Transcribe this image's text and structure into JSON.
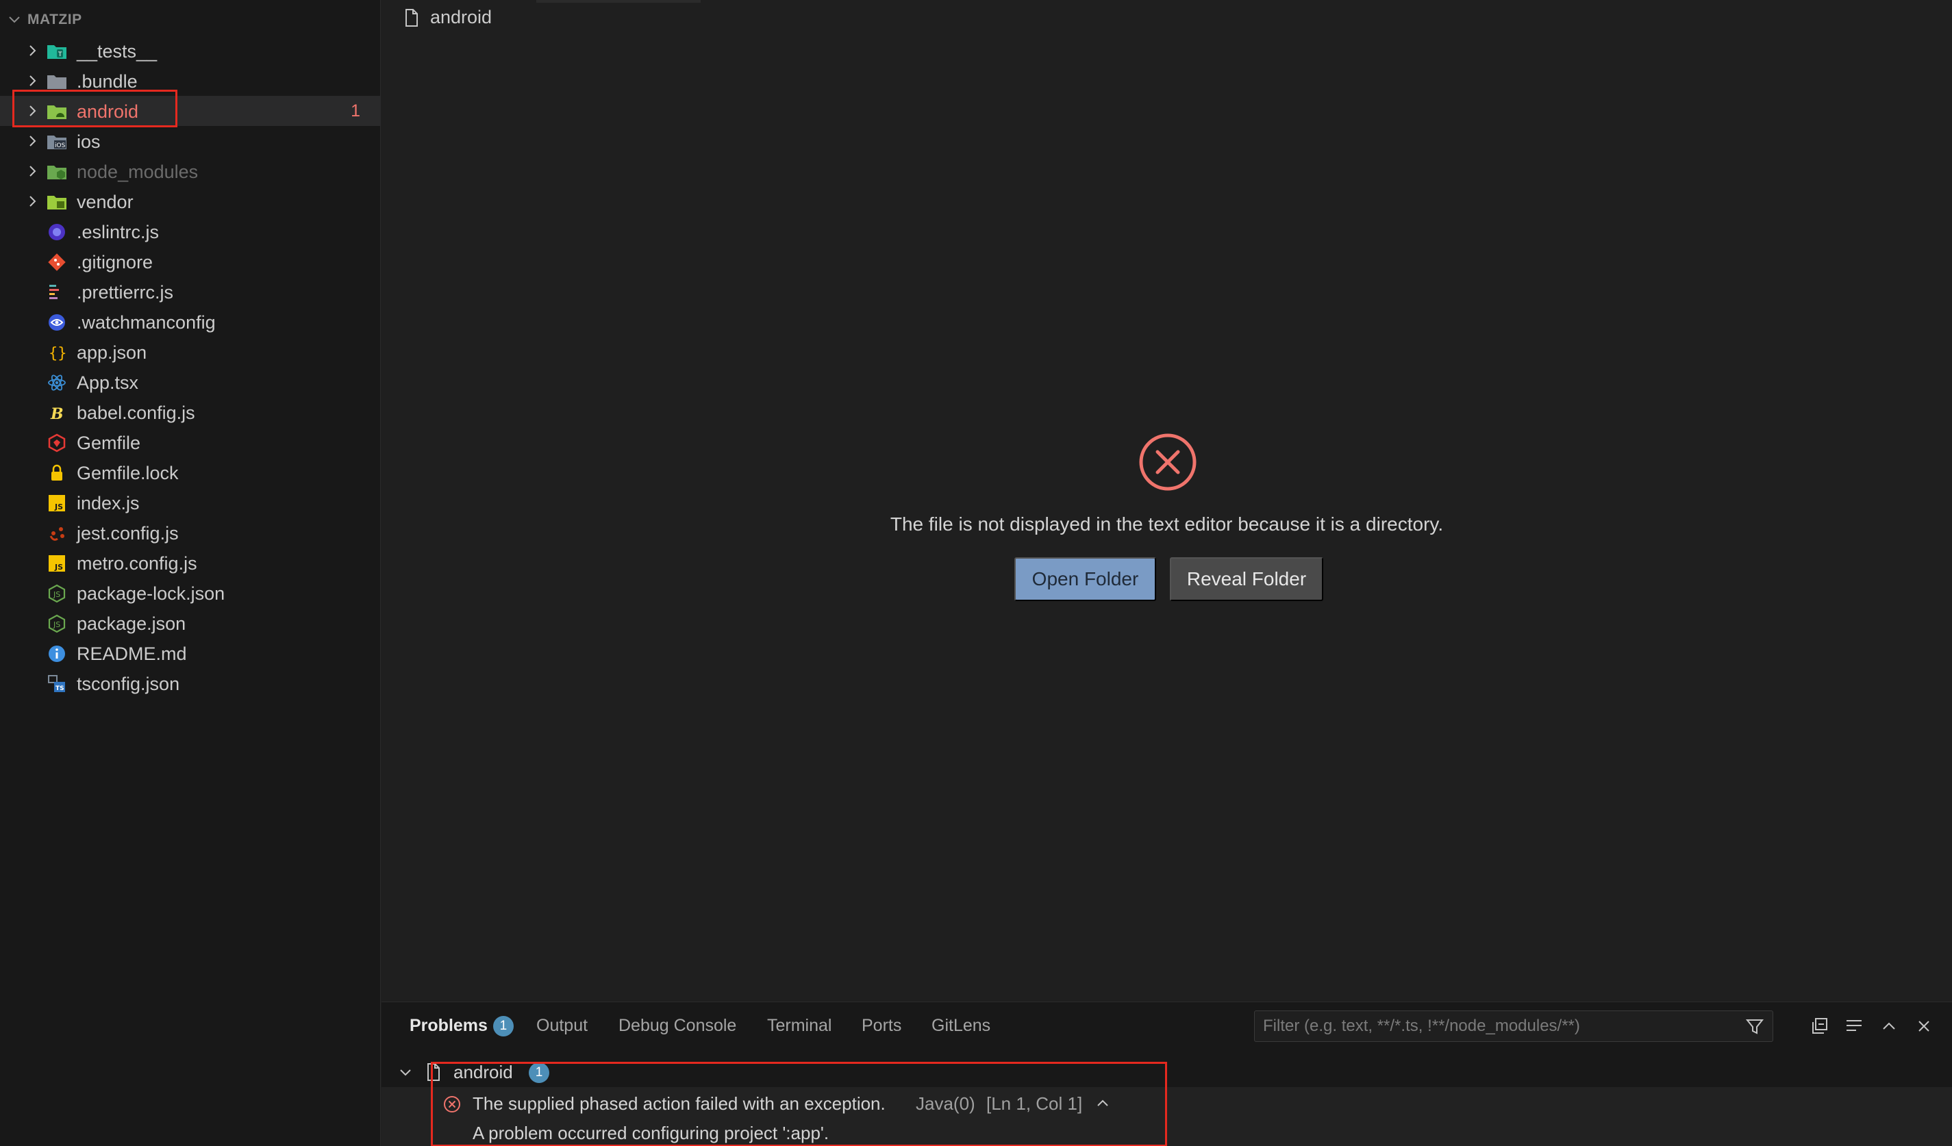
{
  "explorer": {
    "title": "MATZIP",
    "items": [
      {
        "label": "__tests__",
        "type": "folder",
        "icon": "tests-folder-icon"
      },
      {
        "label": ".bundle",
        "type": "folder",
        "icon": "folder-icon"
      },
      {
        "label": "android",
        "type": "folder",
        "icon": "android-folder-icon",
        "badge": "1"
      },
      {
        "label": "ios",
        "type": "folder",
        "icon": "ios-folder-icon"
      },
      {
        "label": "node_modules",
        "type": "folder",
        "icon": "node-folder-icon"
      },
      {
        "label": "vendor",
        "type": "folder",
        "icon": "vendor-folder-icon"
      },
      {
        "label": ".eslintrc.js",
        "type": "file",
        "icon": "eslint-icon"
      },
      {
        "label": ".gitignore",
        "type": "file",
        "icon": "git-icon"
      },
      {
        "label": ".prettierrc.js",
        "type": "file",
        "icon": "prettier-icon"
      },
      {
        "label": ".watchmanconfig",
        "type": "file",
        "icon": "watchman-icon"
      },
      {
        "label": "app.json",
        "type": "file",
        "icon": "json-icon"
      },
      {
        "label": "App.tsx",
        "type": "file",
        "icon": "react-icon"
      },
      {
        "label": "babel.config.js",
        "type": "file",
        "icon": "babel-icon"
      },
      {
        "label": "Gemfile",
        "type": "file",
        "icon": "ruby-gem-icon"
      },
      {
        "label": "Gemfile.lock",
        "type": "file",
        "icon": "lock-icon"
      },
      {
        "label": "index.js",
        "type": "file",
        "icon": "javascript-icon"
      },
      {
        "label": "jest.config.js",
        "type": "file",
        "icon": "jest-icon"
      },
      {
        "label": "metro.config.js",
        "type": "file",
        "icon": "javascript-icon"
      },
      {
        "label": "package-lock.json",
        "type": "file",
        "icon": "node-json-icon"
      },
      {
        "label": "package.json",
        "type": "file",
        "icon": "node-json-icon"
      },
      {
        "label": "README.md",
        "type": "file",
        "icon": "info-icon"
      },
      {
        "label": "tsconfig.json",
        "type": "file",
        "icon": "tsconfig-icon"
      }
    ]
  },
  "editor": {
    "breadcrumb": "android",
    "message": "The file is not displayed in the text editor because it is a directory.",
    "open_folder_label": "Open Folder",
    "reveal_folder_label": "Reveal Folder"
  },
  "panel": {
    "tabs": [
      {
        "label": "Problems",
        "badge": "1"
      },
      {
        "label": "Output"
      },
      {
        "label": "Debug Console"
      },
      {
        "label": "Terminal"
      },
      {
        "label": "Ports"
      },
      {
        "label": "GitLens"
      }
    ],
    "filter_placeholder": "Filter (e.g. text, **/*.ts, !**/node_modules/**)",
    "problem_file": "android",
    "problem_file_count": "1",
    "problem": {
      "message": "The supplied phased action failed with an exception.",
      "source": "Java(0)",
      "location": "[Ln 1, Col 1]",
      "detail": "A problem occurred configuring project ':app'."
    }
  },
  "colors": {
    "error": "#f0746c",
    "highlight_box": "#e5291f",
    "primary_button": "#7a9bc5",
    "secondary_button": "#4a4a4a",
    "badge": "#4d8fb8"
  }
}
